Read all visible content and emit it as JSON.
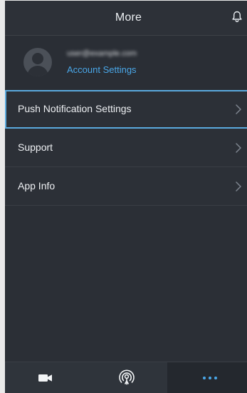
{
  "header": {
    "title": "More",
    "bell_icon": "bell-icon"
  },
  "account": {
    "email": "user@example.com",
    "settings_link": "Account Settings",
    "avatar_icon": "user-avatar-icon"
  },
  "menu": {
    "items": [
      {
        "label": "Push Notification Settings",
        "icon": "chevron-right-icon",
        "selected": true
      },
      {
        "label": "Support",
        "icon": "chevron-right-icon",
        "selected": false
      },
      {
        "label": "App Info",
        "icon": "chevron-right-icon",
        "selected": false
      }
    ]
  },
  "bottom_nav": {
    "tabs": [
      {
        "icon": "video-camera-icon",
        "active": false
      },
      {
        "icon": "broadcast-icon",
        "active": false
      },
      {
        "icon": "more-dots-icon",
        "active": true
      }
    ]
  },
  "colors": {
    "background": "#2b2f36",
    "accent": "#4aa7e8",
    "selection_outline": "#5aa9dd",
    "active_tab": "#24282e"
  }
}
